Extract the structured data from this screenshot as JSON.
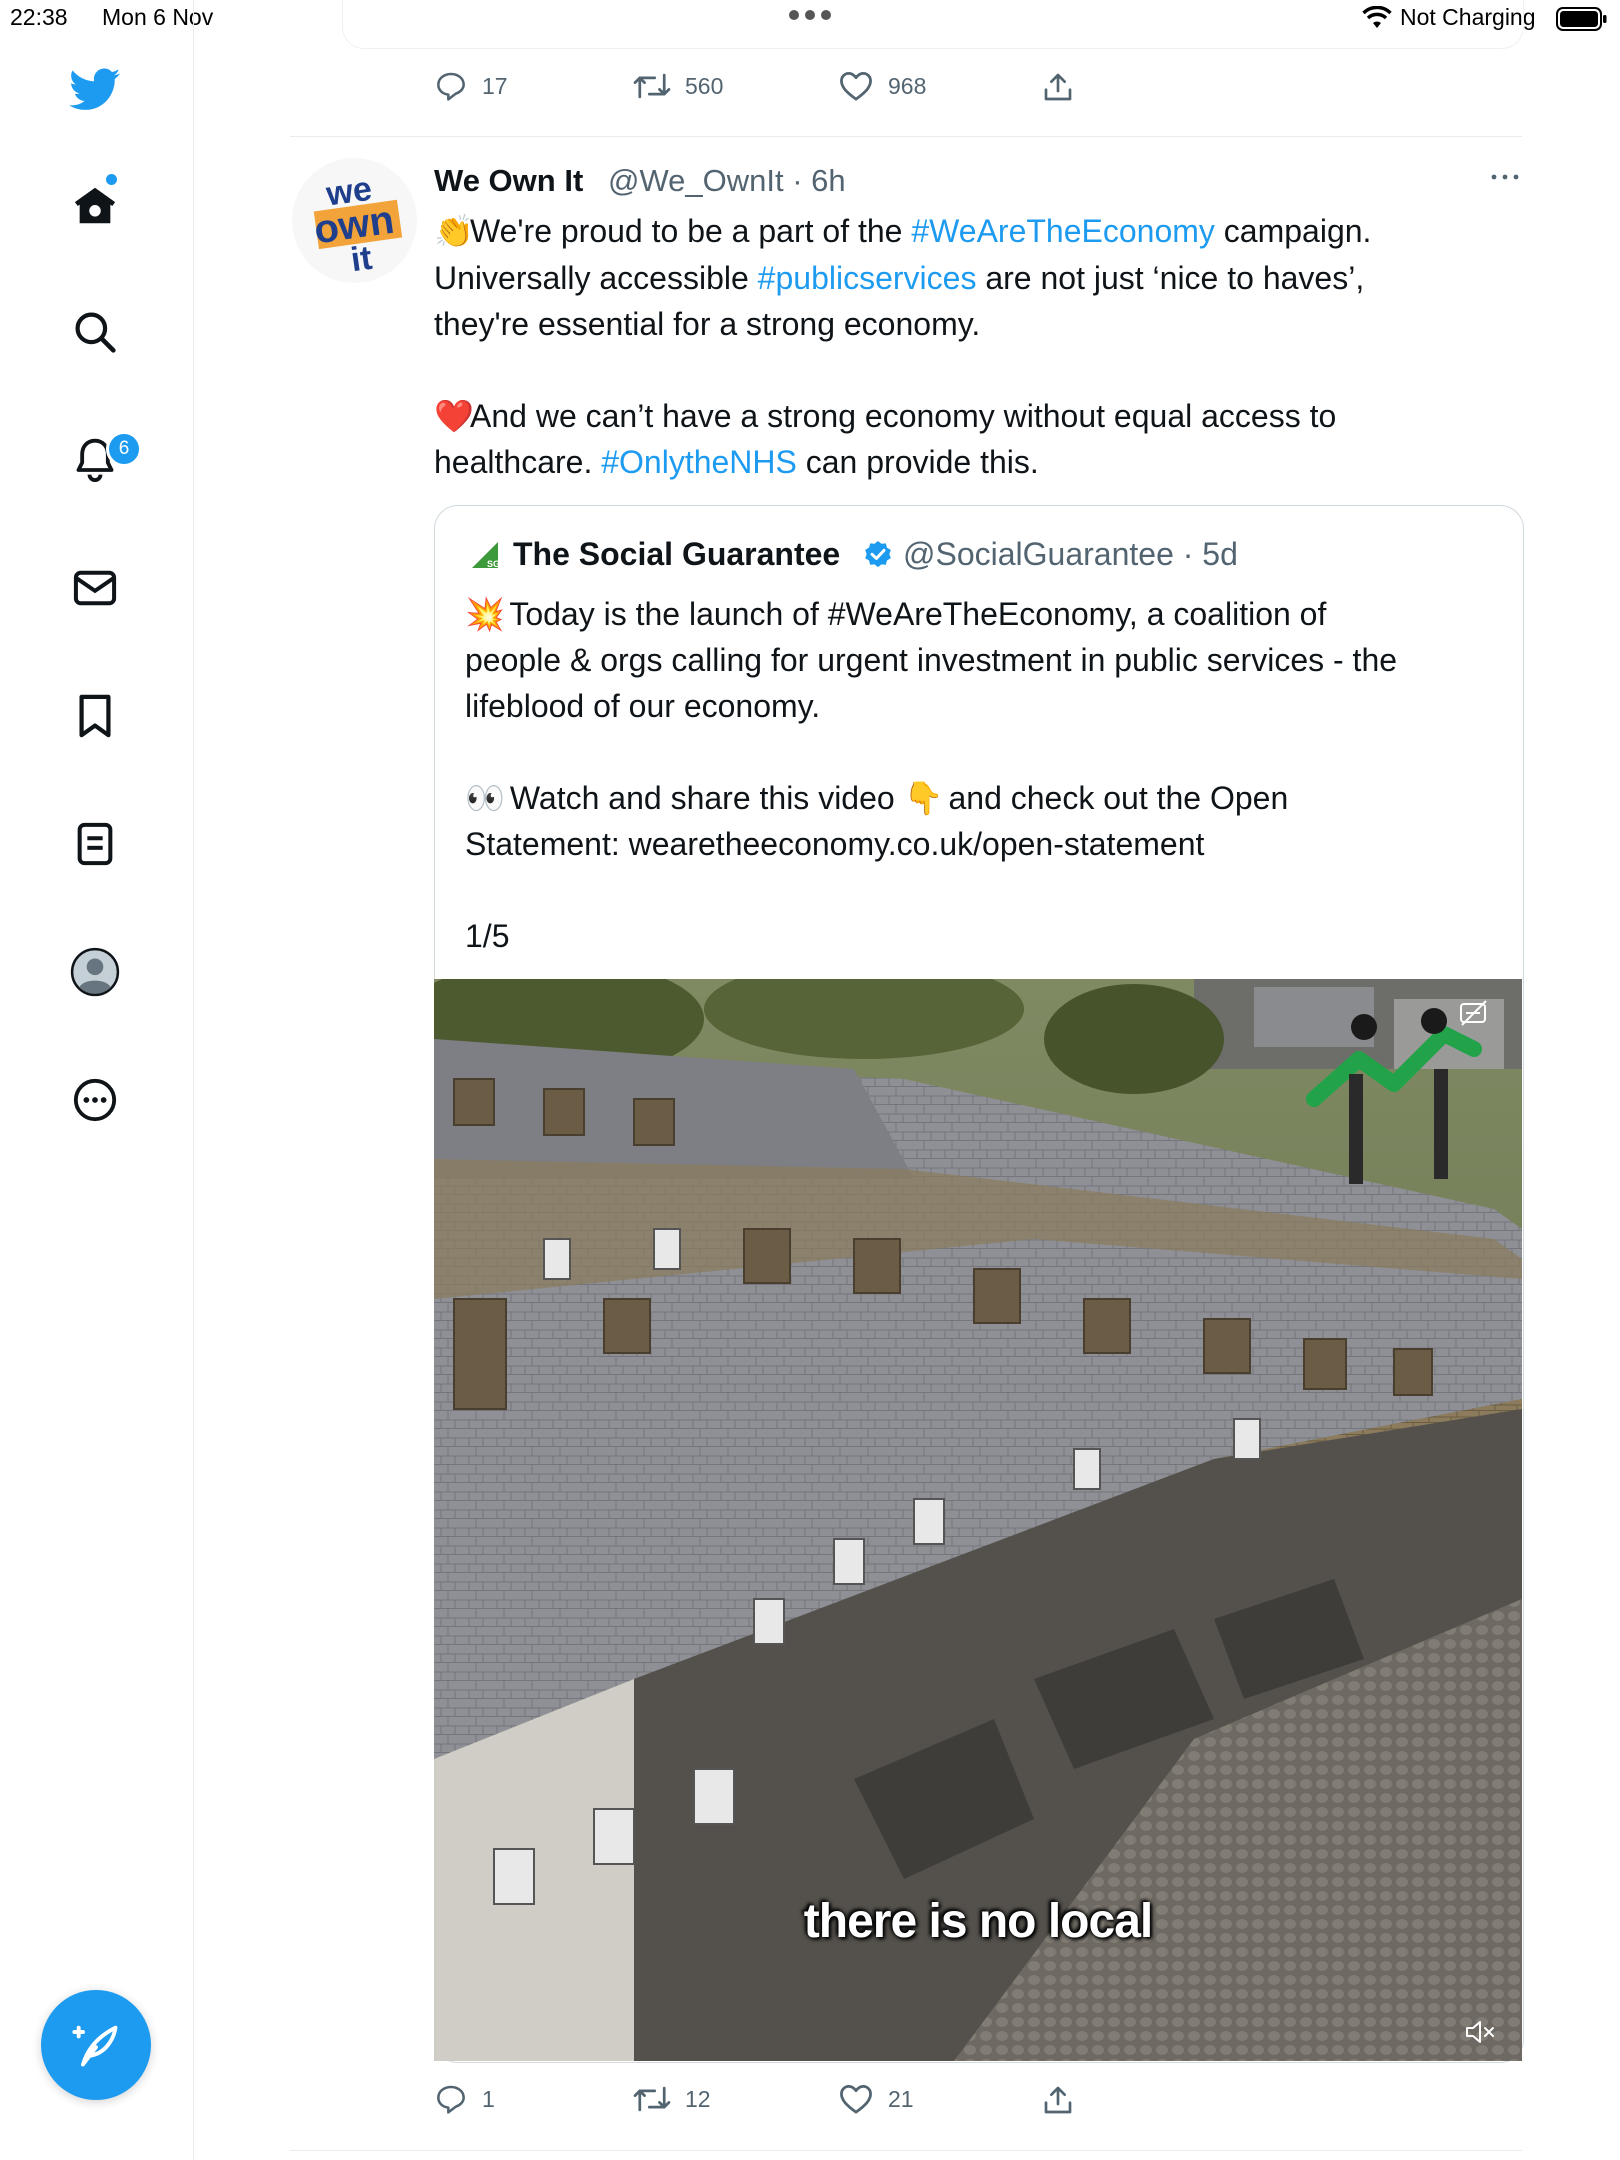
{
  "status_bar": {
    "time": "22:38",
    "date": "Mon 6 Nov",
    "charging": "Not Charging"
  },
  "sidebar": {
    "items": [
      {
        "icon": "twitter-bird-icon"
      },
      {
        "icon": "home-icon"
      },
      {
        "icon": "search-icon"
      },
      {
        "icon": "bell-icon"
      },
      {
        "icon": "mail-icon"
      },
      {
        "icon": "bookmark-icon"
      },
      {
        "icon": "list-icon"
      },
      {
        "icon": "profile-icon"
      },
      {
        "icon": "more-icon"
      }
    ],
    "notification_count": "6"
  },
  "prev_tweet_actions": {
    "replies": "17",
    "retweets": "560",
    "likes": "968"
  },
  "tweet": {
    "author_name": "We Own It",
    "handle_time": "@We_OwnIt · 6h",
    "avatar_text_1": "we",
    "avatar_text_2": "own",
    "avatar_text_3": "it",
    "line1_pre": "We're proud to be a part of the ",
    "line1_tag": "#WeAreTheEconomy",
    "line1_post": " campaign.",
    "line2_pre": "Universally accessible ",
    "line2_tag": "#publicservices",
    "line2_post": " are not just ‘nice to haves’,",
    "line3": "they're essential for a strong economy.",
    "line4": "And we can’t have a strong economy without equal access to",
    "line5_pre": "healthcare. ",
    "line5_tag": "#OnlytheNHS",
    "line5_post": " can provide this.",
    "actions": {
      "replies": "1",
      "retweets": "12",
      "likes": "21"
    }
  },
  "quote": {
    "name": "The Social Guarantee",
    "handle_time": "@SocialGuarantee · 5d",
    "line1": "Today is the launch of #WeAreTheEconomy, a coalition of",
    "line2": "people & orgs calling for urgent investment in public services - the",
    "line3": "lifeblood of our economy.",
    "line4_a": "Watch and share this video",
    "line4_b": "and check out the Open",
    "line5": "Statement: wearetheeconomy.co.uk/open-statement",
    "line6": "1/5",
    "video_caption": "there is no local"
  },
  "colors": {
    "accent": "#1d9bf0",
    "text": "#0f1419",
    "muted": "#536471",
    "border": "#cfd9de"
  }
}
